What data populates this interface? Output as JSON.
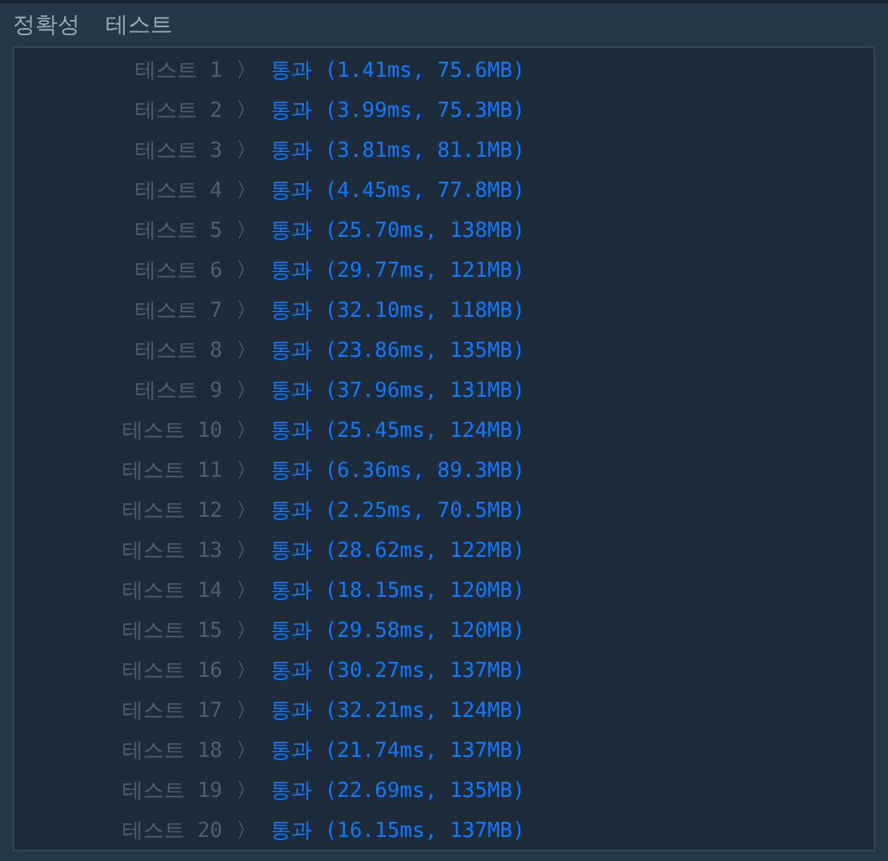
{
  "header": {
    "title": "정확성",
    "subtitle": "테스트"
  },
  "rows": [
    {
      "label": "테스트 1",
      "arrow": "〉",
      "result": "통과 (1.41ms, 75.6MB)",
      "passed": true
    },
    {
      "label": "테스트 2",
      "arrow": "〉",
      "result": "통과 (3.99ms, 75.3MB)",
      "passed": true
    },
    {
      "label": "테스트 3",
      "arrow": "〉",
      "result": "통과 (3.81ms, 81.1MB)",
      "passed": true
    },
    {
      "label": "테스트 4",
      "arrow": "〉",
      "result": "통과 (4.45ms, 77.8MB)",
      "passed": true
    },
    {
      "label": "테스트 5",
      "arrow": "〉",
      "result": "통과 (25.70ms, 138MB)",
      "passed": true
    },
    {
      "label": "테스트 6",
      "arrow": "〉",
      "result": "통과 (29.77ms, 121MB)",
      "passed": true
    },
    {
      "label": "테스트 7",
      "arrow": "〉",
      "result": "통과 (32.10ms, 118MB)",
      "passed": true
    },
    {
      "label": "테스트 8",
      "arrow": "〉",
      "result": "통과 (23.86ms, 135MB)",
      "passed": true
    },
    {
      "label": "테스트 9",
      "arrow": "〉",
      "result": "통과 (37.96ms, 131MB)",
      "passed": true
    },
    {
      "label": "테스트 10",
      "arrow": "〉",
      "result": "통과 (25.45ms, 124MB)",
      "passed": true
    },
    {
      "label": "테스트 11",
      "arrow": "〉",
      "result": "통과 (6.36ms, 89.3MB)",
      "passed": true
    },
    {
      "label": "테스트 12",
      "arrow": "〉",
      "result": "통과 (2.25ms, 70.5MB)",
      "passed": true
    },
    {
      "label": "테스트 13",
      "arrow": "〉",
      "result": "통과 (28.62ms, 122MB)",
      "passed": true
    },
    {
      "label": "테스트 14",
      "arrow": "〉",
      "result": "통과 (18.15ms, 120MB)",
      "passed": true
    },
    {
      "label": "테스트 15",
      "arrow": "〉",
      "result": "통과 (29.58ms, 120MB)",
      "passed": true
    },
    {
      "label": "테스트 16",
      "arrow": "〉",
      "result": "통과 (30.27ms, 137MB)",
      "passed": true
    },
    {
      "label": "테스트 17",
      "arrow": "〉",
      "result": "통과 (32.21ms, 124MB)",
      "passed": true
    },
    {
      "label": "테스트 18",
      "arrow": "〉",
      "result": "통과 (21.74ms, 137MB)",
      "passed": true
    },
    {
      "label": "테스트 19",
      "arrow": "〉",
      "result": "통과 (22.69ms, 135MB)",
      "passed": true
    },
    {
      "label": "테스트 20",
      "arrow": "〉",
      "result": "통과 (16.15ms, 137MB)",
      "passed": true
    }
  ]
}
